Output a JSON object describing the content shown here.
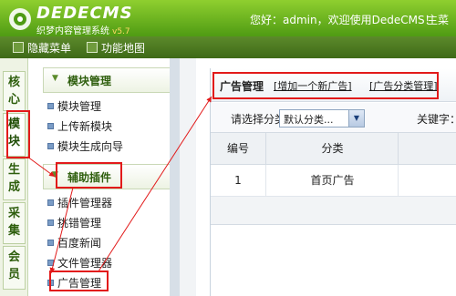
{
  "header": {
    "logo_text": "DEDECMS",
    "logo_subtitle": "织梦内容管理系统",
    "logo_version": "v5.7",
    "welcome": "您好：admin，欢迎使用DedeCMS！",
    "main_site": "主菜"
  },
  "toolbar": {
    "hide_menu": "隐藏菜单",
    "function_map": "功能地图"
  },
  "vtabs": [
    {
      "label": "核心"
    },
    {
      "label": "模块"
    },
    {
      "label": "生成"
    },
    {
      "label": "采集"
    },
    {
      "label": "会员"
    }
  ],
  "menu": {
    "group1_title": "模块管理",
    "group1_items": [
      "模块管理",
      "上传新模块",
      "模块生成向导"
    ],
    "group2_title": "辅助插件",
    "group2_items": [
      "插件管理器",
      "挑错管理",
      "百度新闻",
      "文件管理器",
      "广告管理"
    ]
  },
  "content": {
    "breadcrumb_title": "广告管理",
    "add_new_ad": "[增加一个新广告]",
    "ad_category_manage": "[广告分类管理]",
    "select_category_label": "请选择分类：",
    "category_selected": "默认分类...",
    "keyword_label": "关键字：",
    "table": {
      "headers": [
        "编号",
        "分类"
      ],
      "rows": [
        [
          "1",
          "首页广告"
        ]
      ]
    }
  },
  "colors": {
    "header_green": "#5aa519",
    "highlight_red": "#e21a1a"
  }
}
